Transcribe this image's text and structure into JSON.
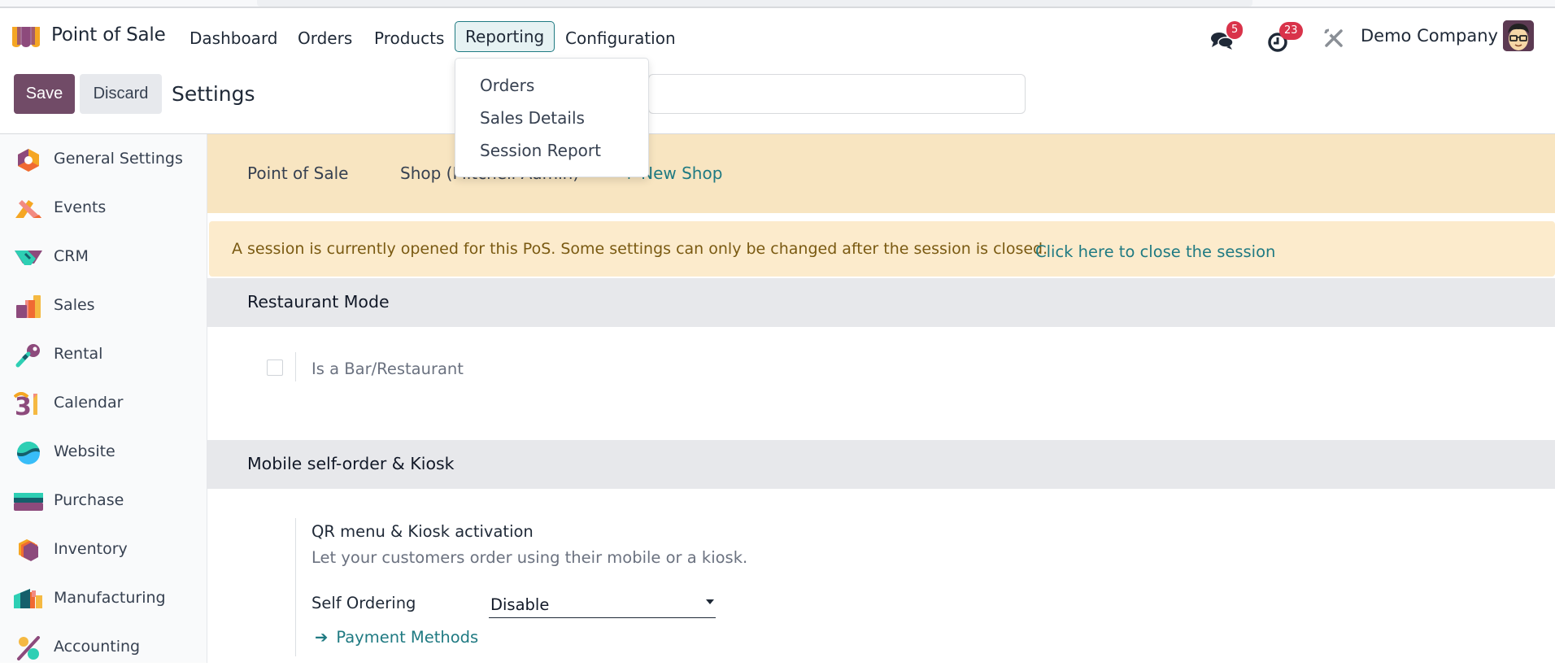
{
  "navbar": {
    "app_name": "Point of Sale",
    "menu": [
      "Dashboard",
      "Orders",
      "Products",
      "Reporting",
      "Configuration"
    ],
    "active_menu": "Reporting",
    "messages_count": "5",
    "activities_count": "23",
    "company": "Demo Company"
  },
  "reporting_dropdown": {
    "items": [
      "Orders",
      "Sales Details",
      "Session Report"
    ]
  },
  "control_panel": {
    "save_label": "Save",
    "discard_label": "Discard",
    "title": "Settings",
    "search_placeholder": ""
  },
  "sidebar": {
    "items": [
      {
        "label": "General Settings",
        "icon": "general-settings-icon"
      },
      {
        "label": "Events",
        "icon": "events-icon"
      },
      {
        "label": "CRM",
        "icon": "crm-icon"
      },
      {
        "label": "Sales",
        "icon": "sales-icon"
      },
      {
        "label": "Rental",
        "icon": "rental-icon"
      },
      {
        "label": "Calendar",
        "icon": "calendar-icon"
      },
      {
        "label": "Website",
        "icon": "website-icon"
      },
      {
        "label": "Purchase",
        "icon": "purchase-icon"
      },
      {
        "label": "Inventory",
        "icon": "inventory-icon"
      },
      {
        "label": "Manufacturing",
        "icon": "manufacturing-icon"
      },
      {
        "label": "Accounting",
        "icon": "accounting-icon"
      }
    ]
  },
  "shop_bar": {
    "label": "Point of Sale",
    "shop_value": "Shop (Mitchell Admin)",
    "new_shop_label": "+ New Shop"
  },
  "alert": {
    "message": "A session is currently opened for this PoS. Some settings can only be changed after the session is closed.",
    "link": "Click here to close the session"
  },
  "sections": {
    "restaurant": {
      "title": "Restaurant Mode",
      "checkbox_label": "Is a Bar/Restaurant",
      "checked": false
    },
    "mobile": {
      "title": "Mobile self-order & Kiosk",
      "setting_title": "QR menu & Kiosk activation",
      "setting_desc": "Let your customers order using their mobile or a kiosk.",
      "self_ordering_label": "Self Ordering",
      "self_ordering_value": "Disable",
      "payment_methods_link": "Payment Methods"
    }
  },
  "colors": {
    "brand": "#714b67",
    "link": "#1f7a82",
    "badge": "#d9334a",
    "shop_band": "#f8e5c1",
    "alert_bg": "#fcebcc"
  }
}
